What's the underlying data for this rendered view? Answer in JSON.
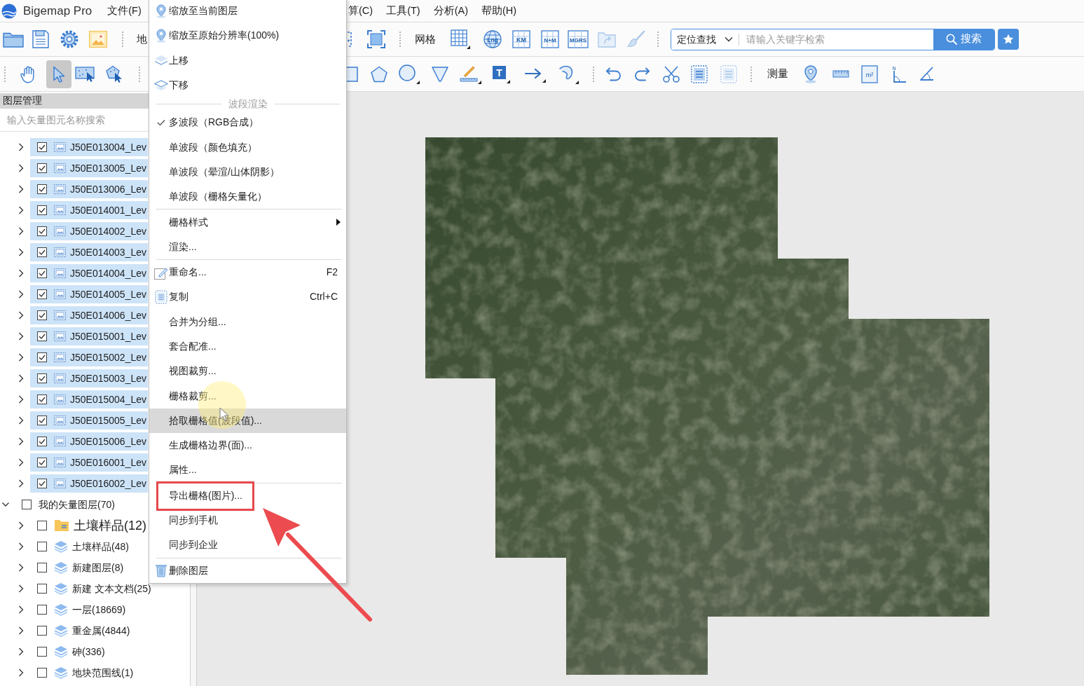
{
  "app_title": "Bigemap Pro",
  "menu_bar": [
    "文件(F)",
    "算(C)",
    "工具(T)",
    "分析(A)",
    "帮助(H)"
  ],
  "toolbar_top": {
    "cut_label": "地",
    "grid_label": "网格",
    "grid_icon_texts": [
      "Lng",
      "KM",
      "N+M",
      "MGRS"
    ],
    "search": {
      "scope": "定位查找",
      "placeholder": "请输入关键字检索",
      "button": "搜索"
    }
  },
  "toolbar_bottom": {
    "tools": [
      {
        "selected": false
      },
      {
        "selected": true
      },
      {
        "selected": false
      },
      {
        "selected": false
      }
    ],
    "text_tool": "T",
    "measure_label": "测量",
    "area_unit": "m²",
    "north": "N"
  },
  "layer_panel": {
    "title": "图层管理",
    "search_placeholder": "输入矢量图元名称搜索",
    "tree": [
      {
        "children": [
          {
            "kind": "raster",
            "name": "J50E013004_Lev",
            "checked": true,
            "selected": true,
            "expanded": false
          },
          {
            "kind": "raster",
            "name": "J50E013005_Lev",
            "checked": true,
            "selected": true,
            "expanded": false
          },
          {
            "kind": "raster",
            "name": "J50E013006_Lev",
            "checked": true,
            "selected": true,
            "expanded": false
          },
          {
            "kind": "raster",
            "name": "J50E014001_Lev",
            "checked": true,
            "selected": true,
            "expanded": false
          },
          {
            "kind": "raster",
            "name": "J50E014002_Lev",
            "checked": true,
            "selected": true,
            "expanded": false
          },
          {
            "kind": "raster",
            "name": "J50E014003_Lev",
            "checked": true,
            "selected": true,
            "expanded": false
          },
          {
            "kind": "raster",
            "name": "J50E014004_Lev",
            "checked": true,
            "selected": true,
            "expanded": false
          },
          {
            "kind": "raster",
            "name": "J50E014005_Lev",
            "checked": true,
            "selected": true,
            "expanded": false
          },
          {
            "kind": "raster",
            "name": "J50E014006_Lev",
            "checked": true,
            "selected": true,
            "expanded": false
          },
          {
            "kind": "raster",
            "name": "J50E015001_Lev",
            "checked": true,
            "selected": true,
            "expanded": false
          },
          {
            "kind": "raster",
            "name": "J50E015002_Lev",
            "checked": true,
            "selected": true,
            "expanded": false
          },
          {
            "kind": "raster",
            "name": "J50E015003_Lev",
            "checked": true,
            "selected": true,
            "expanded": false
          },
          {
            "kind": "raster",
            "name": "J50E015004_Lev",
            "checked": true,
            "selected": true,
            "expanded": false
          },
          {
            "kind": "raster",
            "name": "J50E015005_Lev",
            "checked": true,
            "selected": true,
            "expanded": false
          },
          {
            "kind": "raster",
            "name": "J50E015006_Lev",
            "checked": true,
            "selected": true,
            "expanded": false
          },
          {
            "kind": "raster",
            "name": "J50E016001_Lev",
            "checked": true,
            "selected": true,
            "expanded": false
          },
          {
            "kind": "raster",
            "name": "J50E016002_Lev",
            "checked": true,
            "selected": true,
            "expanded": false
          }
        ]
      },
      {
        "name": "我的矢量图层(70)",
        "checked": false,
        "selected": false,
        "expanded": true,
        "children": [
          {
            "kind": "folder",
            "name": "土壤样品(12)",
            "checked": false,
            "selected": false,
            "expanded": false
          },
          {
            "kind": "layer",
            "name": "土壤样品(48)",
            "checked": false,
            "selected": false,
            "expanded": false
          },
          {
            "kind": "layer",
            "name": "新建图层(8)",
            "checked": false,
            "selected": false,
            "expanded": false
          },
          {
            "kind": "layer",
            "name": "新建 文本文档(25)",
            "checked": false,
            "selected": false,
            "expanded": false
          },
          {
            "kind": "layer",
            "name": "一层(18669)",
            "checked": false,
            "selected": false,
            "expanded": false
          },
          {
            "kind": "layer",
            "name": "重金属(4844)",
            "checked": false,
            "selected": false,
            "expanded": false
          },
          {
            "kind": "layer",
            "name": "砷(336)",
            "checked": false,
            "selected": false,
            "expanded": false
          },
          {
            "kind": "layer",
            "name": "地块范围线(1)",
            "checked": false,
            "selected": false,
            "expanded": false
          }
        ]
      }
    ]
  },
  "context_menu": {
    "items": [
      {
        "kind": "item",
        "label": "缩放至当前图层",
        "checked": false,
        "hovered": false,
        "submenu": false,
        "marked": false
      },
      {
        "kind": "item",
        "label": "缩放至原始分辨率(100%)",
        "checked": false,
        "hovered": false,
        "submenu": false,
        "marked": false
      },
      {
        "kind": "item",
        "label": "上移",
        "checked": false,
        "hovered": false,
        "submenu": false,
        "marked": false
      },
      {
        "kind": "item",
        "label": "下移",
        "checked": false,
        "hovered": false,
        "submenu": false,
        "marked": false
      },
      {
        "kind": "header",
        "label": "波段渲染"
      },
      {
        "kind": "item",
        "label": "多波段（RGB合成）",
        "checked": true,
        "hovered": false,
        "submenu": false,
        "marked": false
      },
      {
        "kind": "item",
        "label": "单波段（颜色填充）",
        "checked": false,
        "hovered": false,
        "submenu": false,
        "marked": false
      },
      {
        "kind": "item",
        "label": "单波段（晕渲/山体阴影）",
        "checked": false,
        "hovered": false,
        "submenu": false,
        "marked": false
      },
      {
        "kind": "item",
        "label": "单波段（栅格矢量化）",
        "checked": false,
        "hovered": false,
        "submenu": false,
        "marked": false
      },
      {
        "kind": "separator"
      },
      {
        "kind": "item",
        "label": "栅格样式",
        "checked": false,
        "hovered": false,
        "submenu": true,
        "marked": false
      },
      {
        "kind": "item",
        "label": "渲染...",
        "checked": false,
        "hovered": false,
        "submenu": false,
        "marked": false
      },
      {
        "kind": "separator"
      },
      {
        "kind": "item",
        "label": "重命名...",
        "shortcut": "F2",
        "checked": false,
        "hovered": false,
        "submenu": false,
        "marked": false
      },
      {
        "kind": "item",
        "label": "复制",
        "shortcut": "Ctrl+C",
        "checked": false,
        "hovered": false,
        "submenu": false,
        "marked": false
      },
      {
        "kind": "item",
        "label": "合并为分组...",
        "checked": false,
        "hovered": false,
        "submenu": false,
        "marked": false
      },
      {
        "kind": "item",
        "label": "套合配准...",
        "checked": false,
        "hovered": false,
        "submenu": false,
        "marked": false
      },
      {
        "kind": "item",
        "label": "视图裁剪...",
        "checked": false,
        "hovered": false,
        "submenu": false,
        "marked": false
      },
      {
        "kind": "item",
        "label": "栅格裁剪...",
        "checked": false,
        "hovered": false,
        "submenu": false,
        "marked": false
      },
      {
        "kind": "item",
        "label": "拾取栅格值(波段值)...",
        "checked": false,
        "hovered": true,
        "submenu": false,
        "marked": false
      },
      {
        "kind": "item",
        "label": "生成栅格边界(面)...",
        "checked": false,
        "hovered": false,
        "submenu": false,
        "marked": false
      },
      {
        "kind": "item",
        "label": "属性...",
        "checked": false,
        "hovered": false,
        "submenu": false,
        "marked": false
      },
      {
        "kind": "separator"
      },
      {
        "kind": "item",
        "label": "导出栅格(图片)...",
        "checked": false,
        "hovered": false,
        "submenu": false,
        "marked": true
      },
      {
        "kind": "item",
        "label": "同步到手机",
        "checked": false,
        "hovered": false,
        "submenu": false,
        "marked": false
      },
      {
        "kind": "item",
        "label": "同步到企业",
        "checked": false,
        "hovered": false,
        "submenu": false,
        "marked": false
      },
      {
        "kind": "separator"
      },
      {
        "kind": "item",
        "label": "删除图层",
        "checked": false,
        "hovered": false,
        "submenu": false,
        "marked": false
      }
    ]
  }
}
